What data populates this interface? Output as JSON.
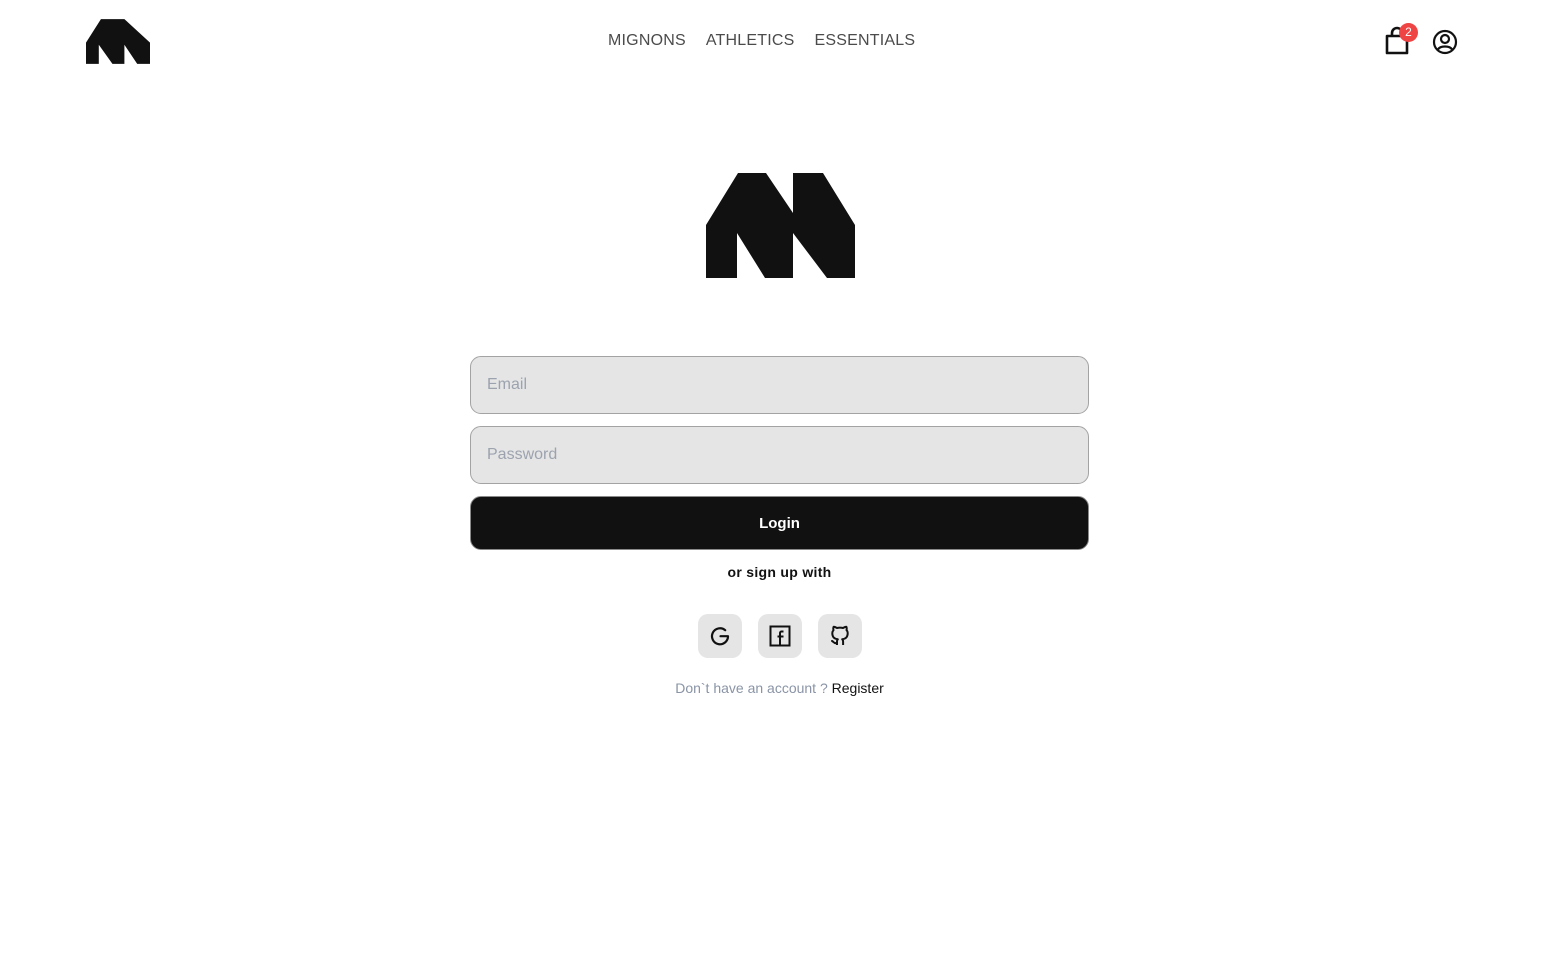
{
  "header": {
    "nav": [
      {
        "label": "MIGNONS"
      },
      {
        "label": "ATHLETICS"
      },
      {
        "label": "ESSENTIALS"
      }
    ],
    "cart_count": "2",
    "icons": {
      "logo": "brand-logo",
      "cart": "shopping-bag-icon",
      "account": "user-circle-icon"
    }
  },
  "form": {
    "email_placeholder": "Email",
    "password_placeholder": "Password",
    "login_label": "Login",
    "alt_text": "or sign up with",
    "social": [
      "google-icon",
      "facebook-icon",
      "github-icon"
    ],
    "no_account_text": "Don`t have an account ?",
    "register_label": "Register"
  },
  "colors": {
    "primary": "#111111",
    "badge": "#ef4444",
    "input_bg": "#e5e5e5",
    "muted_text": "#8a94a6"
  }
}
